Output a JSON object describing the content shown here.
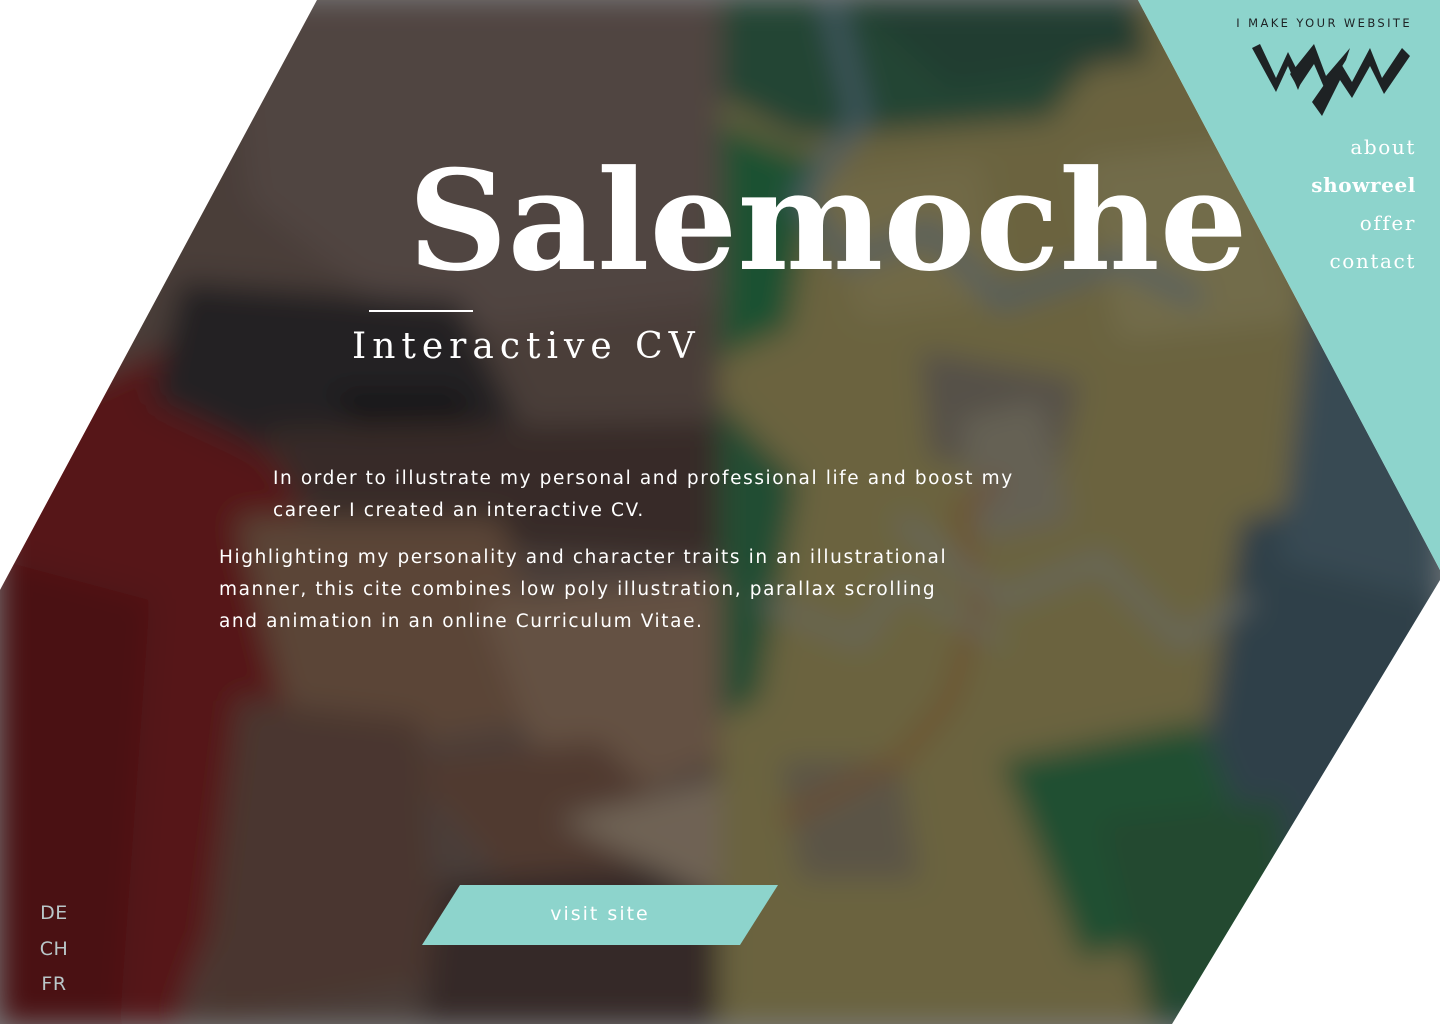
{
  "colors": {
    "accent_teal": "#8dd4cc",
    "dark_overlay": "#1b1d20",
    "text_white": "#ffffff",
    "logo_dark": "#1e2224",
    "lang_text": "#b9c7c9"
  },
  "brand": {
    "tagline": "I MAKE YOUR WEBSITE",
    "logo_icon": "imyw-zigzag-logo-icon"
  },
  "nav": {
    "items": [
      {
        "label": "about",
        "active": false
      },
      {
        "label": "showreel",
        "active": true
      },
      {
        "label": "offer",
        "active": false
      },
      {
        "label": "contact",
        "active": false
      }
    ]
  },
  "hero": {
    "title": "Salemoche",
    "subtitle": "Interactive CV",
    "paragraph_1": "In order to illustrate my personal and professional life and boost my career I created an interactive CV.",
    "paragraph_2": "Highlighting my personality and character traits in an illustrational manner, this cite combines low poly illustration, parallax scrolling and animation in an online Curriculum Vitae.",
    "cta_label": "visit site"
  },
  "languages": [
    "DE",
    "CH",
    "FR"
  ]
}
